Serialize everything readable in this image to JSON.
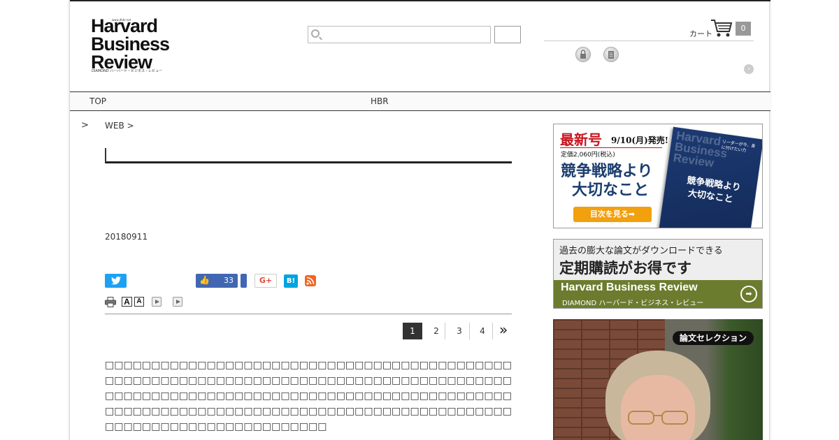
{
  "header": {
    "logo": {
      "url": "www.dhbr.net",
      "line1": "Harvard",
      "line2": "Business",
      "line3": "Review",
      "subtitle": "DIAMOND ハーバード・ビジネス・レビュー"
    },
    "search": {
      "value": "",
      "placeholder": ""
    },
    "search_button_label": "",
    "cart": {
      "label": "カート",
      "count": "0"
    },
    "icons": [
      "lock-icon",
      "book-icon"
    ]
  },
  "nav": {
    "items": [
      "TOP",
      "HBR"
    ]
  },
  "article": {
    "breadcrumb_sep": ">",
    "breadcrumb": "WEB >",
    "date": "20180911",
    "share": {
      "fb_like_count": "33",
      "gplus_label": "G+",
      "hatena_label": "B!"
    },
    "font_sizes": [
      "A",
      "A"
    ],
    "pager": {
      "pages": [
        "1",
        "2",
        "3",
        "4"
      ],
      "current": "1",
      "next": "»"
    },
    "paragraphs": [
      "□□□□□□□□□□□□□□□□□□□□□□□□□□□□□□□□□□□□□□□□□□□□□□□□□□□□□□□□□□□□□□□□□□□□□□□□□□□□□□□□□□□□□□□□",
      "□□□□□□□□□□□□□□□□□□□□□□□□□□□□□□□□□□□□□□□□□□□□□□□□□□□□□□□□□□□□□□□□□□□□□□□□□□□□□□□□□□□□□□□□□□□□□□□□□□□□□□□□□□□□□□□□"
    ]
  },
  "sidebar": {
    "ad1": {
      "headline": "最新号",
      "release": "9/10(月)発売!",
      "price": "定価2,060円(税込)",
      "title_line1": "競争戦略より",
      "title_line2": "大切なこと",
      "button": "目次を見る➡",
      "cover_title": "Harvard Business Review",
      "cover_line1": "競争戦略より",
      "cover_line2": "大切なこと",
      "cover_side": "リーダーが今、身に付けたい力"
    },
    "ad2": {
      "line1": "過去の膨大な論文がダウンロードできる",
      "line2": "定期購読がお得です",
      "brand": "Harvard Business Review",
      "brand_sub": "DIAMOND ハーバード・ビジネス・レビュー"
    },
    "ad3": {
      "badge": "論文セレクション"
    }
  }
}
